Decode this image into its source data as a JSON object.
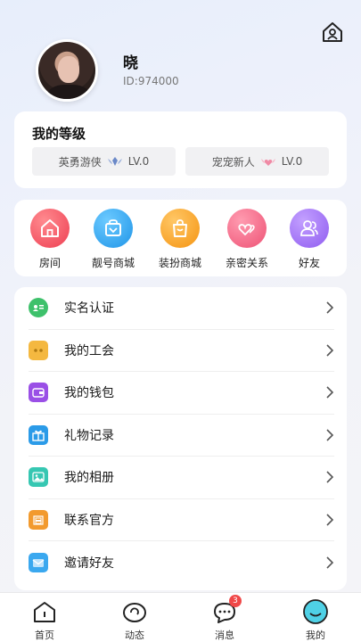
{
  "profile": {
    "nickname": "晓",
    "uid": "ID:974000"
  },
  "level": {
    "title": "我的等级",
    "badges": [
      {
        "label": "英勇游侠",
        "level": "LV.0"
      },
      {
        "label": "宠宠新人",
        "level": "LV.0"
      }
    ]
  },
  "quick": [
    {
      "label": "房间",
      "icon": "house-icon",
      "color": "#f25563"
    },
    {
      "label": "靓号商城",
      "icon": "shop-bag-icon",
      "color": "#2ba8f0"
    },
    {
      "label": "装扮商城",
      "icon": "shopping-bag-icon",
      "color": "#f7a01e"
    },
    {
      "label": "亲密关系",
      "icon": "hearts-icon",
      "color": "#f0607c"
    },
    {
      "label": "好友",
      "icon": "friends-icon",
      "color": "#9e6df2"
    }
  ],
  "menu": [
    {
      "label": "实名认证",
      "icon": "id-card-icon",
      "color": "#3ec16b"
    },
    {
      "label": "我的工会",
      "icon": "guild-icon",
      "color": "#f4b840"
    },
    {
      "label": "我的钱包",
      "icon": "wallet-icon",
      "color": "#9a4fe6"
    },
    {
      "label": "礼物记录",
      "icon": "gift-icon",
      "color": "#2b9be8"
    },
    {
      "label": "我的相册",
      "icon": "album-icon",
      "color": "#36c7b2"
    },
    {
      "label": "联系官方",
      "icon": "official-icon",
      "color": "#f29a2e"
    },
    {
      "label": "邀请好友",
      "icon": "invite-icon",
      "color": "#3aa8ef"
    }
  ],
  "tabbar": [
    {
      "label": "首页",
      "icon": "home-tab-icon"
    },
    {
      "label": "动态",
      "icon": "moments-tab-icon"
    },
    {
      "label": "消息",
      "icon": "message-tab-icon",
      "badge": "3"
    },
    {
      "label": "我的",
      "icon": "me-tab-icon",
      "active": true,
      "color": "#4fd1e6"
    }
  ]
}
